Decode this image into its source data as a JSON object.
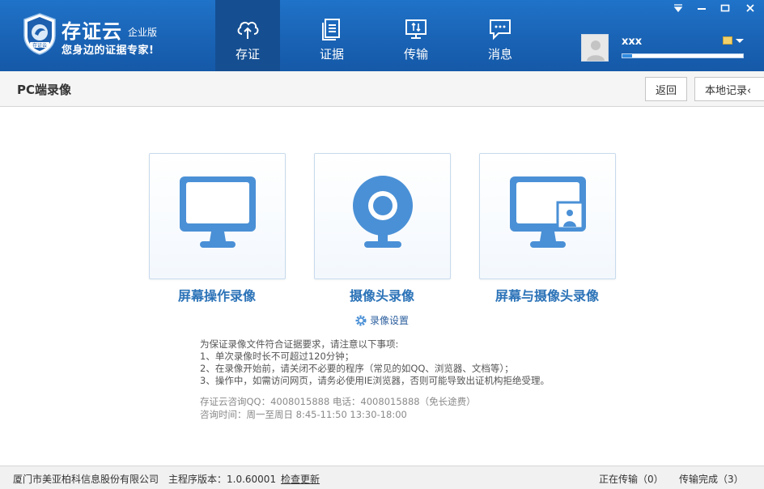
{
  "app": {
    "brand_name": "存证云",
    "brand_edition": "企业版",
    "brand_slogan": "您身边的证据专家!",
    "logo_text": "存证云"
  },
  "nav": [
    {
      "label": "存证",
      "icon": "cloud-upload-icon",
      "active": true
    },
    {
      "label": "证据",
      "icon": "documents-icon",
      "active": false
    },
    {
      "label": "传输",
      "icon": "transfer-icon",
      "active": false
    },
    {
      "label": "消息",
      "icon": "message-icon",
      "active": false
    }
  ],
  "window_controls": [
    "dropdown-icon",
    "minimize-icon",
    "maximize-icon",
    "close-icon"
  ],
  "user": {
    "name": "xxx",
    "storage_used_fraction": 0.08
  },
  "titlebar": {
    "title": "PC端录像",
    "back_label": "返回",
    "local_records_label": "本地记录‹"
  },
  "record_options": [
    {
      "label": "屏幕操作录像",
      "icon": "monitor-icon"
    },
    {
      "label": "摄像头录像",
      "icon": "webcam-icon"
    },
    {
      "label": "屏幕与摄像头录像",
      "icon": "monitor-webcam-icon"
    }
  ],
  "settings_link_label": "录像设置",
  "notes": [
    "为保证录像文件符合证据要求，请注意以下事项:",
    "1、单次录像时长不可超过120分钟；",
    "2、在录像开始前，请关闭不必要的程序（常见的如QQ、浏览器、文档等）；",
    "3、操作中，如需访问网页，请务必使用IE浏览器，否则可能导致出证机构拒绝受理。"
  ],
  "contact": [
    "存证云咨询QQ：4008015888 电话：4008015888（免长途费）",
    "咨询时间：周一至周日 8:45-11:50 13:30-18:00"
  ],
  "footer": {
    "company": "厦门市美亚柏科信息股份有限公司",
    "version": "主程序版本：1.0.60001",
    "check_update": "检查更新",
    "transferring": "正在传输（0）",
    "completed": "传输完成（3）"
  },
  "colors": {
    "header_blue": "#1a63b5",
    "active_tab": "#154f92",
    "icon_blue": "#4a90d6",
    "label_blue": "#2c73b8"
  }
}
